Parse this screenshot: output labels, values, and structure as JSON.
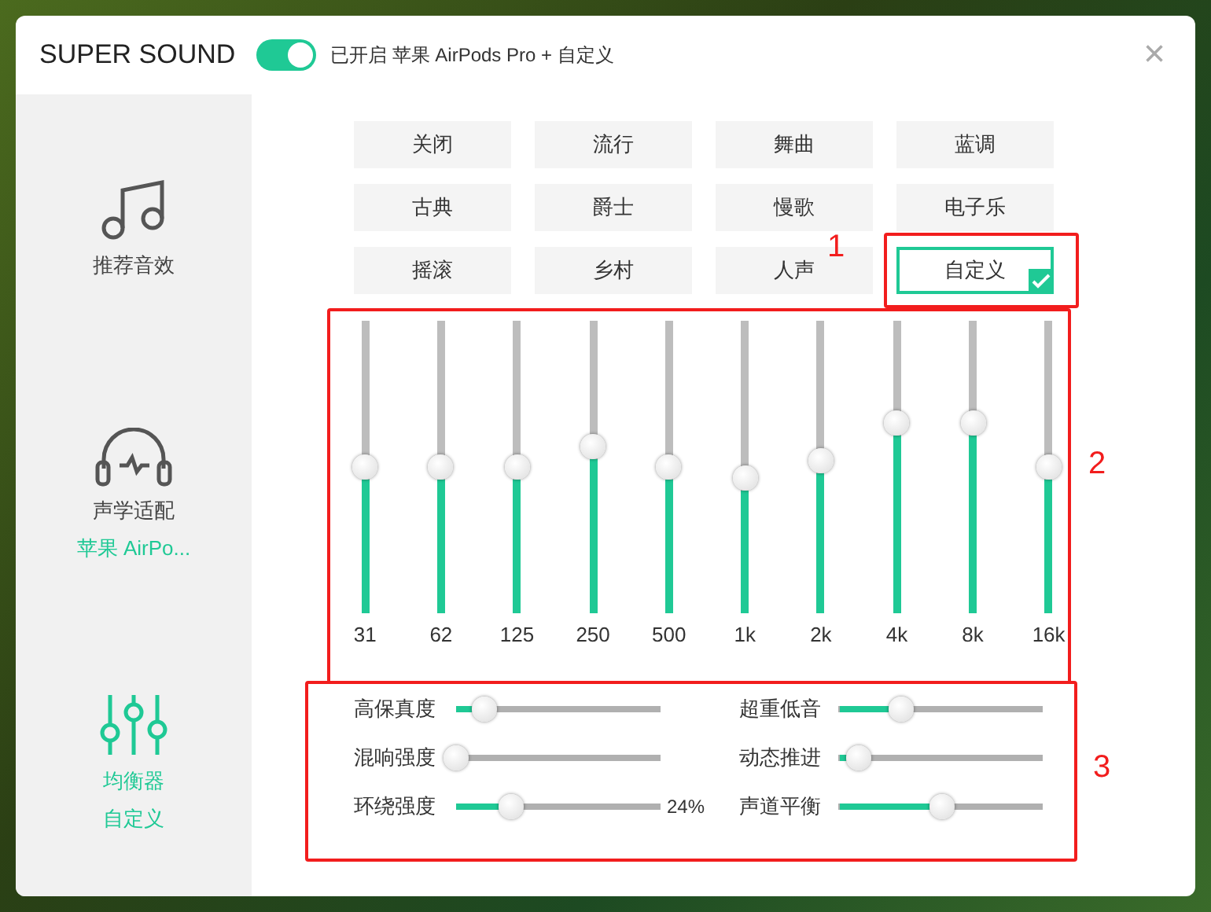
{
  "window": {
    "title": "SUPER SOUND",
    "close": "×"
  },
  "master_switch": {
    "on": true,
    "status": "已开启 苹果 AirPods Pro + 自定义"
  },
  "sidebar": {
    "items": [
      {
        "kind": "music",
        "label": "推荐音效",
        "selected": false
      },
      {
        "kind": "headphones",
        "label": "声学适配",
        "sub": "苹果 AirPo...",
        "selected": false
      },
      {
        "kind": "equalizer",
        "label": "均衡器",
        "sub": "自定义",
        "selected": true
      }
    ]
  },
  "presets": [
    {
      "label": "关闭",
      "selected": false
    },
    {
      "label": "流行",
      "selected": false
    },
    {
      "label": "舞曲",
      "selected": false
    },
    {
      "label": "蓝调",
      "selected": false
    },
    {
      "label": "古典",
      "selected": false
    },
    {
      "label": "爵士",
      "selected": false
    },
    {
      "label": "慢歌",
      "selected": false
    },
    {
      "label": "电子乐",
      "selected": false
    },
    {
      "label": "摇滚",
      "selected": false
    },
    {
      "label": "乡村",
      "selected": false
    },
    {
      "label": "人声",
      "selected": false
    },
    {
      "label": "自定义",
      "selected": true
    }
  ],
  "bands": [
    {
      "label": "31",
      "level": 0.5
    },
    {
      "label": "62",
      "level": 0.5
    },
    {
      "label": "125",
      "level": 0.5
    },
    {
      "label": "250",
      "level": 0.57
    },
    {
      "label": "500",
      "level": 0.5
    },
    {
      "label": "1k",
      "level": 0.46
    },
    {
      "label": "2k",
      "level": 0.52
    },
    {
      "label": "4k",
      "level": 0.65
    },
    {
      "label": "8k",
      "level": 0.65
    },
    {
      "label": "16k",
      "level": 0.5
    }
  ],
  "effects": [
    {
      "label": "高保真度",
      "level": 0.14
    },
    {
      "label": "超重低音",
      "level": 0.3
    },
    {
      "label": "混响强度",
      "level": 0.0
    },
    {
      "label": "动态推进",
      "level": 0.09
    },
    {
      "label": "环绕强度",
      "level": 0.27,
      "reading": "24%"
    },
    {
      "label": "声道平衡",
      "level": 0.5
    }
  ],
  "annotations": [
    {
      "label": "1"
    },
    {
      "label": "2"
    },
    {
      "label": "3"
    }
  ]
}
